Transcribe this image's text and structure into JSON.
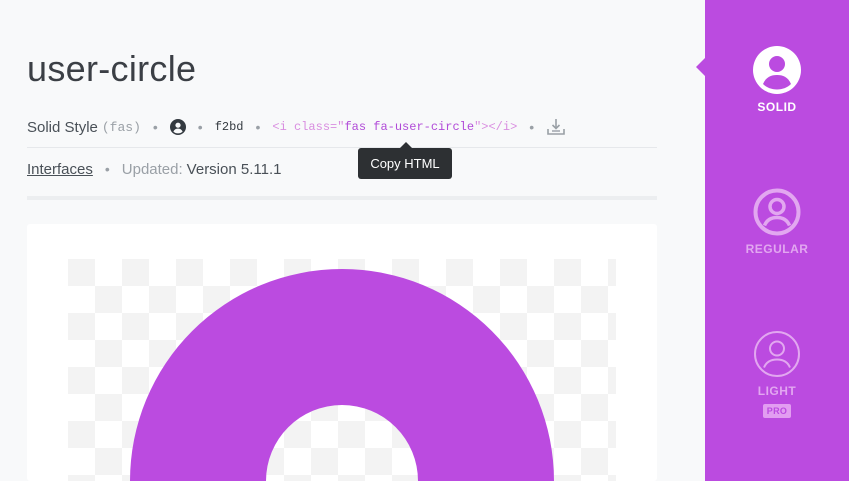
{
  "icon": {
    "name": "user-circle",
    "style_name": "Solid Style",
    "style_prefix": "(fas)",
    "unicode": "f2bd",
    "code_open": "<i class=\"",
    "code_class": "fas fa-user-circle",
    "code_close": "\"></i>",
    "category": "Interfaces",
    "updated_label": "Updated:",
    "version": "Version 5.11.1"
  },
  "tooltip": {
    "text": "Copy HTML"
  },
  "sidebar": {
    "styles": [
      {
        "label": "SOLID"
      },
      {
        "label": "REGULAR"
      },
      {
        "label": "LIGHT",
        "badge": "PRO"
      }
    ]
  },
  "colors": {
    "accent": "#bb4be0",
    "icon_preview": "#bb4be0",
    "tooltip_bg": "#2d3033"
  },
  "icons": [
    "user-circle-icon",
    "download-icon"
  ]
}
